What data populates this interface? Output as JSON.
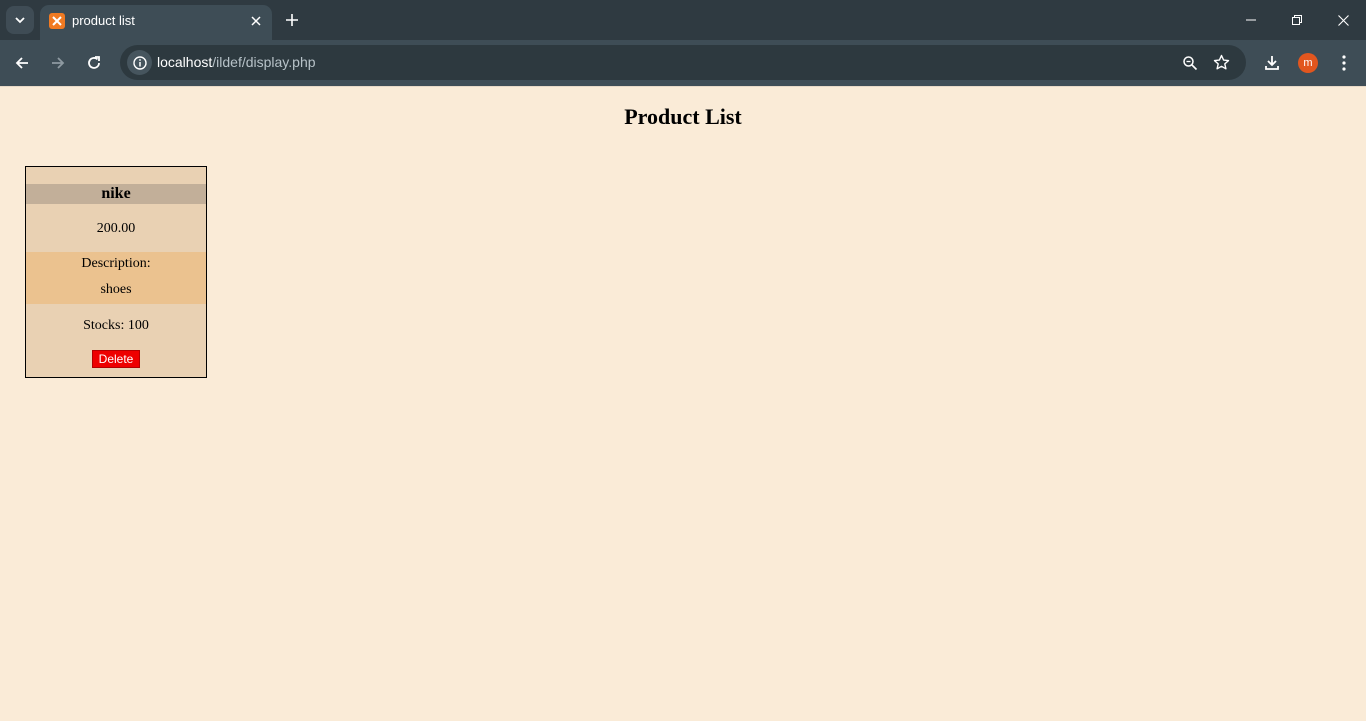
{
  "browser": {
    "tab_title": "product list",
    "url_host": "localhost",
    "url_path": "/ildef/display.php",
    "profile_initial": "m",
    "colors": {
      "tabstrip": "#2f3a41",
      "toolbar": "#3e4d56",
      "favicon": "#f07a22",
      "avatar": "#e2561e"
    }
  },
  "page": {
    "title": "Product List",
    "background": "#faebd7"
  },
  "products": [
    {
      "name": "nike",
      "price": "200.00",
      "description_label": "Description:",
      "description": "shoes",
      "stock_text": "Stocks: 100",
      "delete_label": "Delete"
    }
  ]
}
